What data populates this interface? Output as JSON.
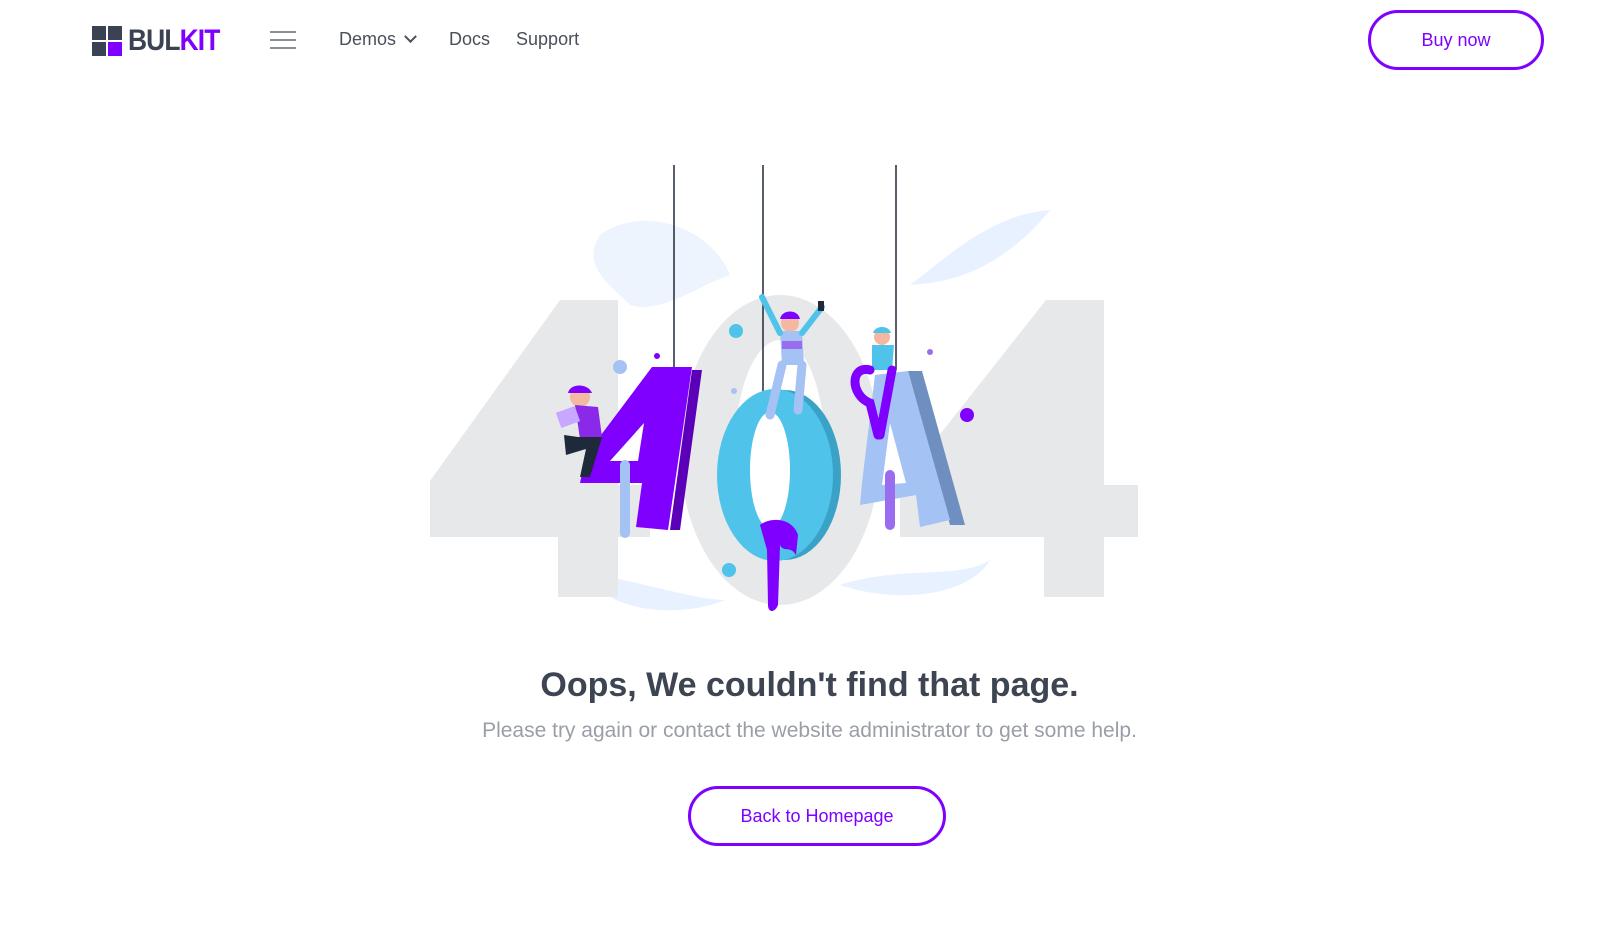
{
  "brand": {
    "name_part1": "BUL",
    "name_part2": "KIT",
    "accent_color": "#7f00ff",
    "dark_color": "#3b4253"
  },
  "nav": {
    "menu_icon": "hamburger-menu-icon",
    "links": [
      {
        "label": "Demos",
        "has_dropdown": true
      },
      {
        "label": "Docs"
      },
      {
        "label": "Support"
      }
    ],
    "cta_label": "Buy now"
  },
  "error": {
    "code": "404",
    "title": "Oops, We couldn't find that page.",
    "message": "Please try again or contact the website administrator to get some help.",
    "button_label": "Back to Homepage"
  },
  "colors": {
    "purple": "#7f00ff",
    "sky": "#4fc3ea",
    "periwinkle": "#a4c2f4",
    "ghost_digits": "#e7e8ea"
  }
}
